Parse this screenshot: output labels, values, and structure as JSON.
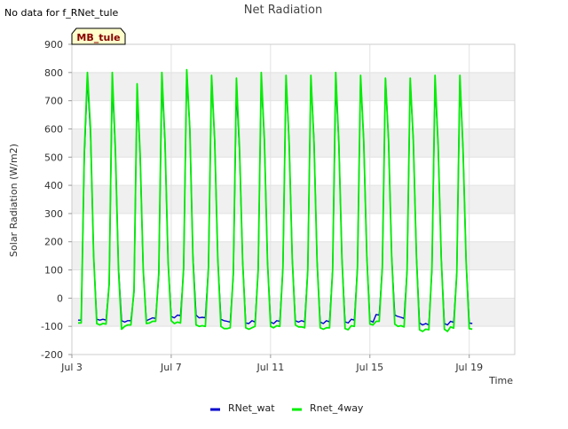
{
  "notice": "No data for f_RNet_tule",
  "site_badge": "MB_tule",
  "colors": {
    "RNet_wat": "#0000cc",
    "Rnet_4way": "#00ee00",
    "band": "#f0f0f0",
    "badge_bg": "#ffffcc",
    "badge_text": "#880000"
  },
  "chart_data": {
    "type": "line",
    "title": "Net Radiation",
    "xlabel": "Time",
    "ylabel": "Solar Radiation (W/m2)",
    "xlim": [
      "2023-07-03T00:00",
      "2023-07-20T20:00"
    ],
    "ylim": [
      -200,
      900
    ],
    "yticks": [
      -200,
      -100,
      0,
      100,
      200,
      300,
      400,
      500,
      600,
      700,
      800,
      900
    ],
    "xticks": [
      {
        "date": "2023-07-03",
        "label": "Jul 3"
      },
      {
        "date": "2023-07-07",
        "label": "Jul 7"
      },
      {
        "date": "2023-07-11",
        "label": "Jul 11"
      },
      {
        "date": "2023-07-15",
        "label": "Jul 15"
      },
      {
        "date": "2023-07-19",
        "label": "Jul 19"
      }
    ],
    "grid": true,
    "legend_position": "bottom",
    "series_interval_hours": 3,
    "series": [
      {
        "name": "RNet_wat",
        "start": "2023-07-03T06:00",
        "values": [
          -78,
          -78,
          500,
          780,
          580,
          150,
          -75,
          -78,
          -75,
          -78,
          50,
          770,
          520,
          110,
          -80,
          -85,
          -80,
          -80,
          20,
          740,
          500,
          100,
          -80,
          -75,
          -70,
          -72,
          80,
          770,
          550,
          130,
          -65,
          -70,
          -60,
          -62,
          100,
          800,
          600,
          150,
          -60,
          -70,
          -68,
          -70,
          110,
          780,
          560,
          140,
          -75,
          -80,
          -82,
          -85,
          80,
          740,
          520,
          130,
          -88,
          -90,
          -80,
          -85,
          100,
          780,
          560,
          130,
          -85,
          -90,
          -80,
          -82,
          110,
          780,
          550,
          140,
          -80,
          -85,
          -80,
          -84,
          100,
          780,
          560,
          130,
          -85,
          -90,
          -80,
          -84,
          100,
          760,
          550,
          140,
          -84,
          -88,
          -75,
          -78,
          110,
          780,
          560,
          150,
          -80,
          -85,
          -58,
          -60,
          110,
          780,
          560,
          150,
          -60,
          -65,
          -68,
          -72,
          100,
          770,
          560,
          150,
          -88,
          -95,
          -90,
          -95,
          100,
          760,
          540,
          140,
          -90,
          -95,
          -82,
          -86,
          90,
          780,
          530,
          130,
          -88,
          -90
        ]
      },
      {
        "name": "Rnet_4way",
        "start": "2023-07-03T06:00",
        "values": [
          -88,
          -88,
          520,
          800,
          600,
          150,
          -90,
          -95,
          -90,
          -92,
          50,
          800,
          530,
          100,
          -110,
          -100,
          -95,
          -95,
          30,
          760,
          510,
          100,
          -90,
          -88,
          -82,
          -82,
          90,
          800,
          560,
          130,
          -80,
          -90,
          -85,
          -88,
          110,
          810,
          600,
          140,
          -95,
          -100,
          -98,
          -100,
          110,
          790,
          560,
          140,
          -100,
          -108,
          -108,
          -105,
          90,
          780,
          530,
          130,
          -105,
          -110,
          -105,
          -100,
          100,
          800,
          560,
          130,
          -100,
          -105,
          -98,
          -100,
          110,
          790,
          550,
          140,
          -95,
          -102,
          -102,
          -105,
          100,
          790,
          550,
          130,
          -105,
          -110,
          -105,
          -105,
          100,
          800,
          550,
          140,
          -108,
          -112,
          -98,
          -100,
          110,
          790,
          560,
          150,
          -92,
          -95,
          -82,
          -82,
          110,
          780,
          560,
          150,
          -92,
          -100,
          -98,
          -102,
          100,
          780,
          560,
          150,
          -112,
          -118,
          -110,
          -112,
          110,
          790,
          540,
          140,
          -110,
          -118,
          -102,
          -106,
          90,
          790,
          530,
          130,
          -108,
          -110
        ]
      }
    ]
  }
}
